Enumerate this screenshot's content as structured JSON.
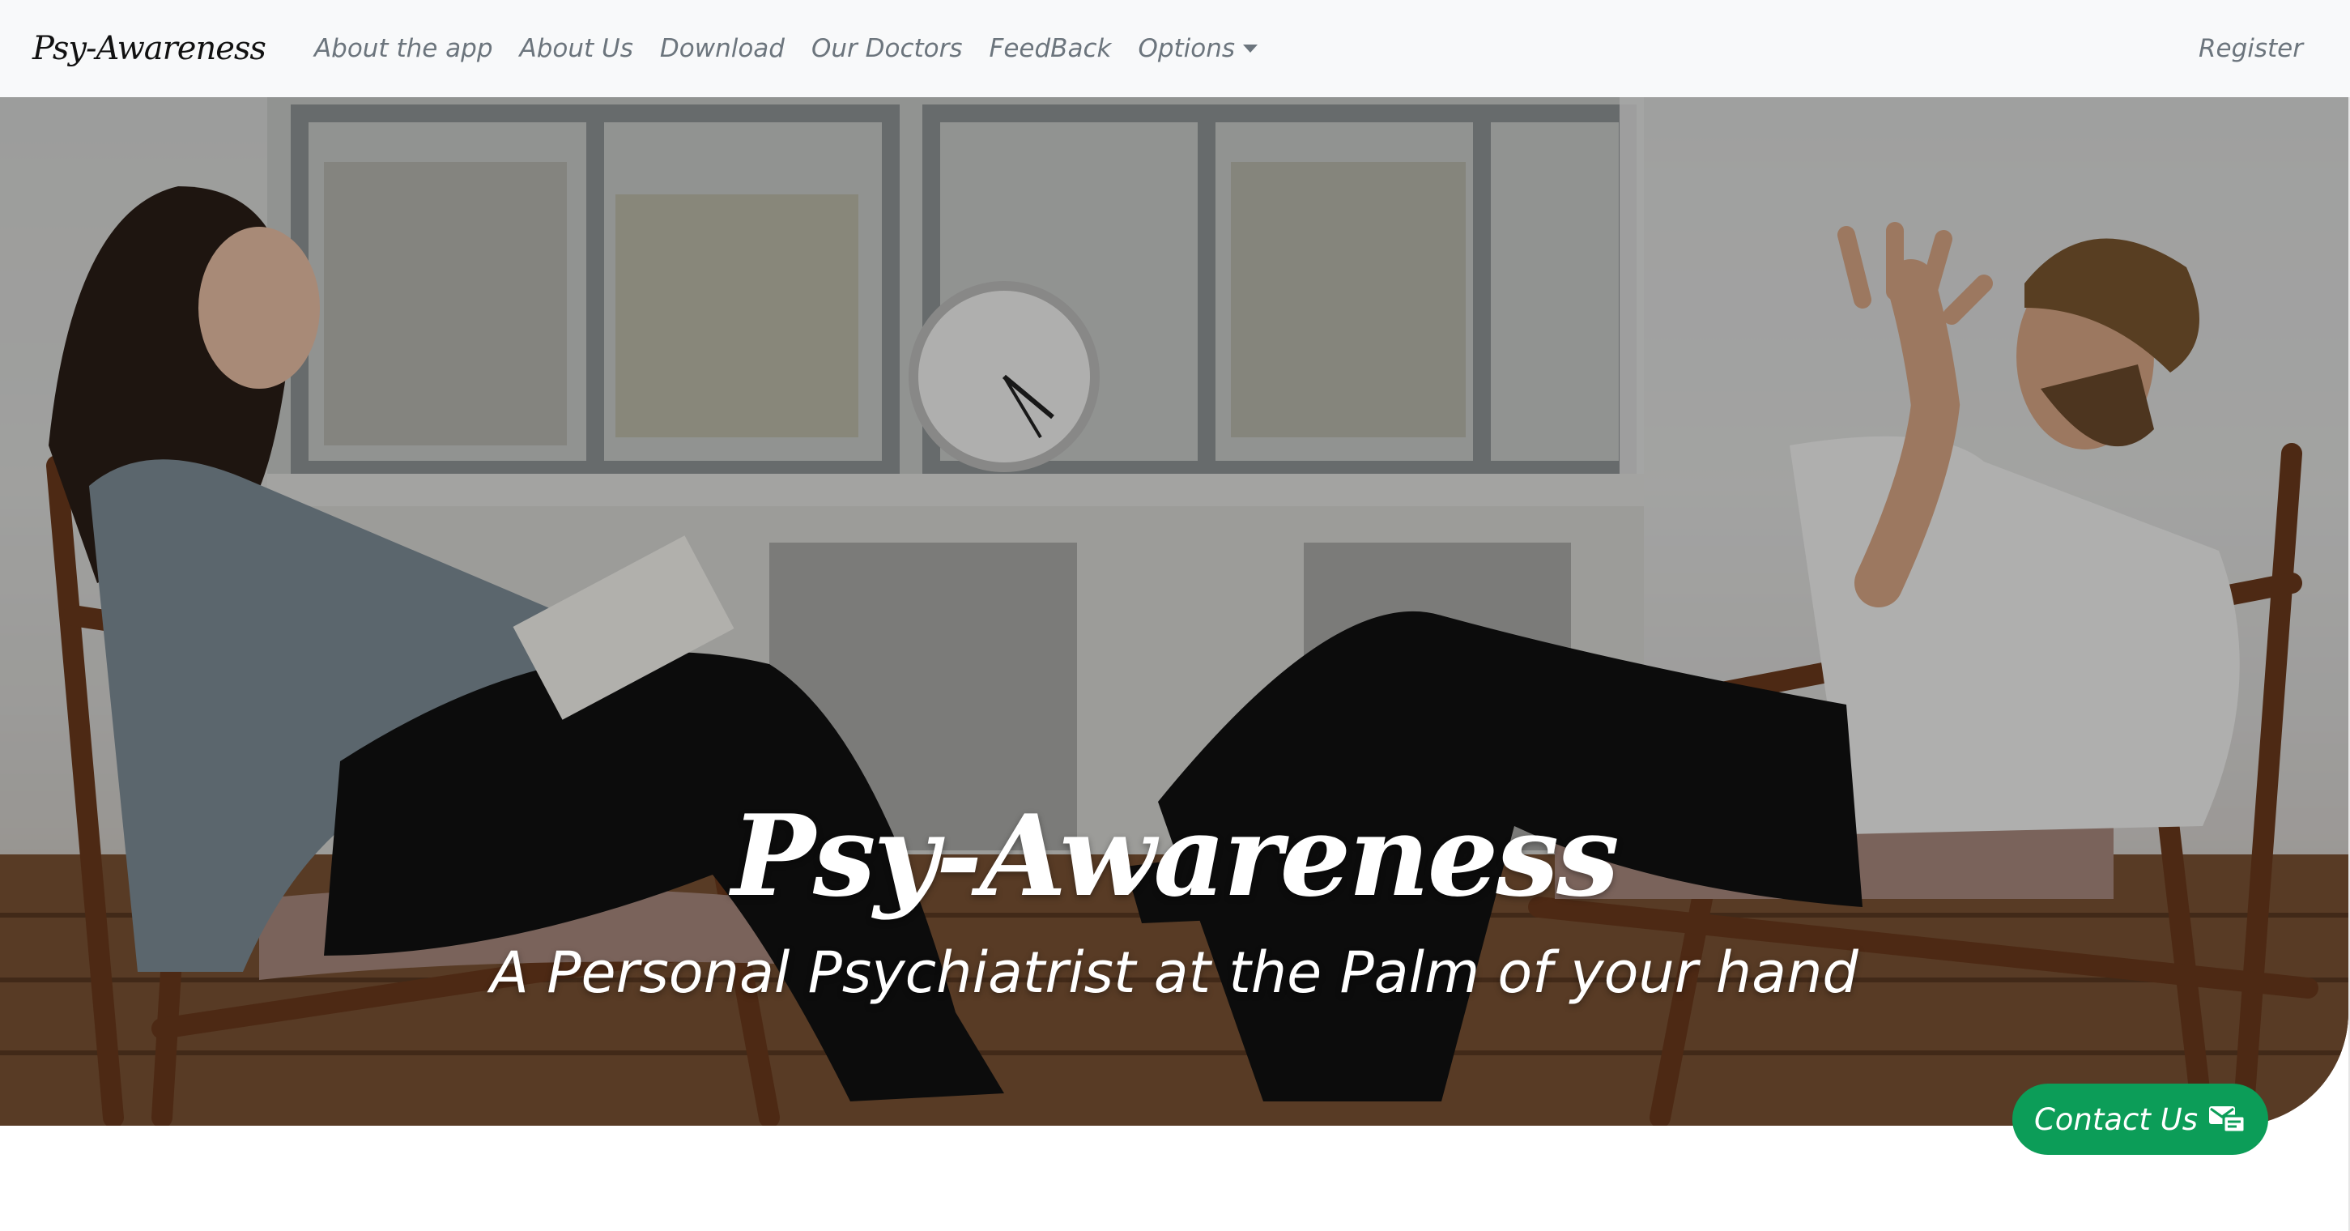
{
  "navbar": {
    "brand": "Psy-Awareness",
    "links": [
      {
        "label": "About the app"
      },
      {
        "label": "About Us"
      },
      {
        "label": "Download"
      },
      {
        "label": "Our Doctors"
      },
      {
        "label": "FeedBack"
      }
    ],
    "options_label": "Options",
    "register_label": "Register"
  },
  "hero": {
    "title": "Psy-Awareness",
    "subtitle": "A Personal Psychiatrist at the Palm of your hand",
    "image": "therapy-session-photo"
  },
  "contact": {
    "label": "Contact Us",
    "icon": "contact-envelope-icon",
    "color": "#0c9d58"
  },
  "colors": {
    "navbar_bg": "#f8f9fa",
    "nav_text": "#6c757d",
    "brand_text": "#111111"
  }
}
